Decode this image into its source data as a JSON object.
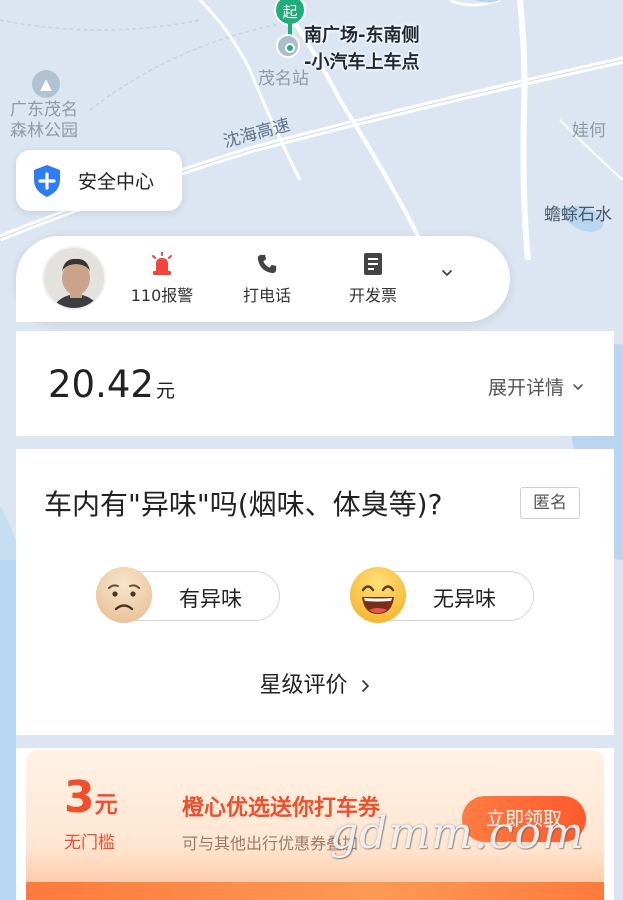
{
  "map": {
    "start_pin": "起",
    "pickup_line1": "南广场-东南侧",
    "pickup_line2": "-小汽车上车点",
    "station": "茂名站",
    "park_line1": "广东茂名",
    "park_line2": "森林公园",
    "highway": "沈海高速",
    "village": "娃何",
    "lake": "蟾蜍石水"
  },
  "safety": {
    "label": "安全中心",
    "icon": "shield-plus-icon"
  },
  "driver": {
    "actions": [
      {
        "label": "110报警",
        "icon": "alarm-light-icon"
      },
      {
        "label": "打电话",
        "icon": "phone-icon"
      },
      {
        "label": "开发票",
        "icon": "invoice-icon"
      }
    ]
  },
  "fare": {
    "amount": "20.42",
    "unit": "元",
    "detail_label": "展开详情"
  },
  "odor": {
    "question": "车内有\"异味\"吗(烟味、体臭等)?",
    "anonymous": "匿名",
    "option_yes": "有异味",
    "option_no": "无异味",
    "rating_label": "星级评价"
  },
  "promo": {
    "amount": "3",
    "unit": "元",
    "threshold": "无门槛",
    "title": "橙心优选送你打车券",
    "subtitle": "可与其他出行优惠券叠加",
    "button": "立即领取"
  },
  "watermark": "gdmm.com",
  "colors": {
    "accent_orange": "#ef4f2c",
    "start_green": "#1fae7a",
    "shield_blue": "#2f7cf6",
    "alarm_red": "#f0463c"
  }
}
